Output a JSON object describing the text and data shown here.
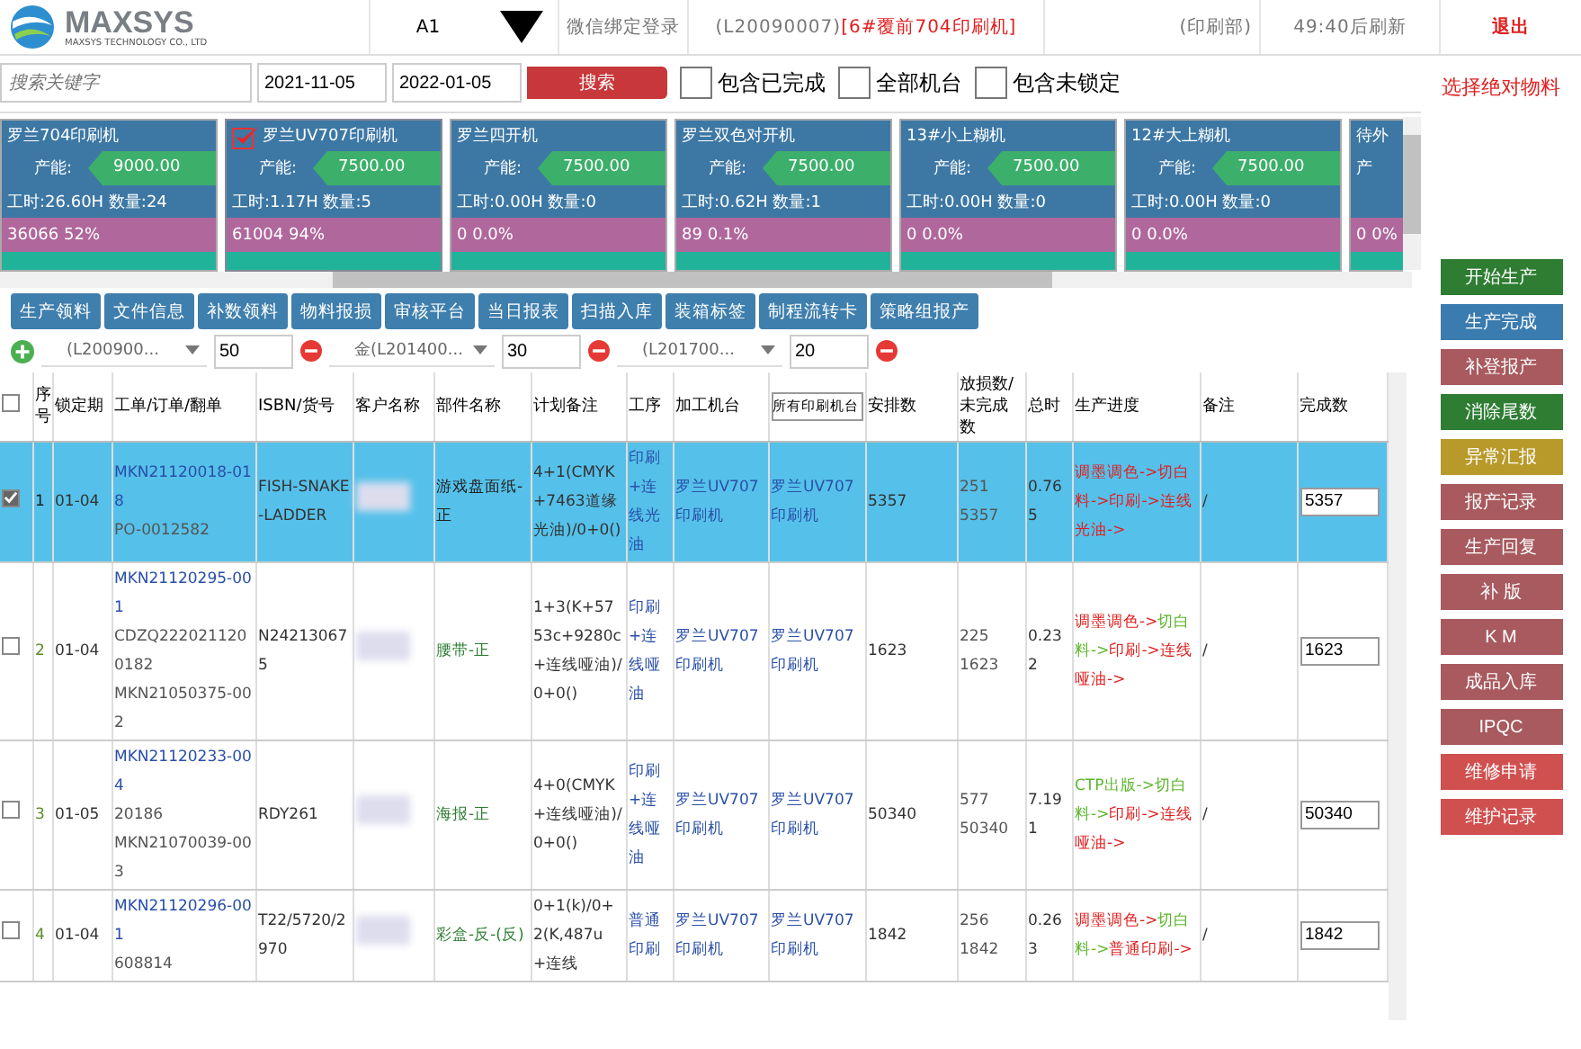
{
  "header": {
    "company": "MAXSYS",
    "tagline": "MAXSYS TECHNOLOGY CO., LTD",
    "station": "A1",
    "wechat_login": "微信绑定登录",
    "user": "(L20090007)",
    "machine": "[6#覆前704印刷机]",
    "department": "(印刷部)",
    "refresh": "49:40后刷新",
    "logout": "退出"
  },
  "search": {
    "placeholder": "搜索关键字",
    "date_from": "2021-11-05",
    "date_to": "2022-01-05",
    "button": "搜索",
    "options": [
      {
        "label": "包含已完成",
        "checked": false
      },
      {
        "label": "全部机台",
        "checked": false
      },
      {
        "label": "包含未锁定",
        "checked": false
      }
    ],
    "absolute_material": "选择绝对物料"
  },
  "machines": [
    {
      "name": "罗兰704印刷机",
      "selected": false,
      "capacity_label": "产能:",
      "capacity": "9000.00",
      "hours": "工时:26.60H 数量:24",
      "rate": "36066 52%"
    },
    {
      "name": "罗兰UV707印刷机",
      "selected": true,
      "capacity_label": "产能:",
      "capacity": "7500.00",
      "hours": "工时:1.17H 数量:5",
      "rate": "61004 94%"
    },
    {
      "name": "罗兰四开机",
      "selected": false,
      "capacity_label": "产能:",
      "capacity": "7500.00",
      "hours": "工时:0.00H 数量:0",
      "rate": "0 0.0%"
    },
    {
      "name": "罗兰双色对开机",
      "selected": false,
      "capacity_label": "产能:",
      "capacity": "7500.00",
      "hours": "工时:0.62H 数量:1",
      "rate": "89 0.1%"
    },
    {
      "name": "13#小上糊机",
      "selected": false,
      "capacity_label": "产能:",
      "capacity": "7500.00",
      "hours": "工时:0.00H 数量:0",
      "rate": "0 0.0%"
    },
    {
      "name": "12#大上糊机",
      "selected": false,
      "capacity_label": "产能:",
      "capacity": "7500.00",
      "hours": "工时:0.00H 数量:0",
      "rate": "0 0.0%"
    },
    {
      "name": "待外",
      "selected": false,
      "capacity_label": "产",
      "rate": "0 0%"
    }
  ],
  "toolbar": [
    "生产领料",
    "文件信息",
    "补数领料",
    "物料报损",
    "审核平台",
    "当日报表",
    "扫描入库",
    "装箱标签",
    "制程流转卡",
    "策略组报产"
  ],
  "materials": [
    {
      "item": "(L200900...",
      "qty": "50"
    },
    {
      "item": "金(L201400...",
      "qty": "30"
    },
    {
      "item": "(L201700...",
      "qty": "20"
    }
  ],
  "table": {
    "select_all_checked": false,
    "columns": [
      "序号",
      "锁定期",
      "工单/订单/翻单",
      "ISBN/货号",
      "客户名称",
      "部件名称",
      "计划备注",
      "工序",
      "加工机台",
      "所有印刷机台",
      "安排数",
      "放损数/未完成数",
      "总时",
      "生产进度",
      "备注",
      "完成数"
    ],
    "rows": [
      {
        "selected": true,
        "seq": "1",
        "date": "01-04",
        "orders": [
          "MKN21120018-018",
          "PO-0012582"
        ],
        "isbn": "FISH-SNAKE-LADDER",
        "part": "游戏盘面纸-正",
        "plan": "4+1(CMYK+7463道缘光油)/0+0()",
        "process": "印刷+连线光油",
        "machine": "罗兰UV707印刷机",
        "printer": "罗兰UV707印刷机",
        "arranged": "5357",
        "loss": "251",
        "remaining": "5357",
        "hours": "0.765",
        "steps": [
          {
            "text": "调墨调色->",
            "done": false
          },
          {
            "text": "切白料->",
            "done": false
          },
          {
            "text": "印刷->",
            "done": false
          },
          {
            "text": "连线光油->",
            "done": false
          }
        ],
        "note": "/",
        "completed": "5357"
      },
      {
        "selected": false,
        "seq": "2",
        "date": "01-04",
        "orders": [
          "MKN21120295-001",
          "CDZQ2220211200182",
          "MKN21050375-002"
        ],
        "isbn": "N242130675",
        "part": "腰带-正",
        "plan": "1+3(K+5753c+9280c+连线哑油)/0+0()",
        "process": "印刷+连线哑油",
        "machine": "罗兰UV707印刷机",
        "printer": "罗兰UV707印刷机",
        "arranged": "1623",
        "loss": "225",
        "remaining": "1623",
        "hours": "0.232",
        "steps": [
          {
            "text": "调墨调色->",
            "done": false
          },
          {
            "text": "切白料->",
            "done": true
          },
          {
            "text": "印刷->",
            "done": false
          },
          {
            "text": "连线哑油->",
            "done": false
          }
        ],
        "note": "/",
        "completed": "1623"
      },
      {
        "selected": false,
        "seq": "3",
        "date": "01-05",
        "orders": [
          "MKN21120233-004",
          "20186",
          "MKN21070039-003"
        ],
        "isbn": "RDY261",
        "part": "海报-正",
        "plan": "4+0(CMYK+连线哑油)/0+0()",
        "process": "印刷+连线哑油",
        "machine": "罗兰UV707印刷机",
        "printer": "罗兰UV707印刷机",
        "arranged": "50340",
        "loss": "577",
        "remaining": "50340",
        "hours": "7.191",
        "steps": [
          {
            "text": "CTP出版->",
            "done": true
          },
          {
            "text": "切白料->",
            "done": true
          },
          {
            "text": "印刷->",
            "done": false
          },
          {
            "text": "连线哑油->",
            "done": false
          }
        ],
        "note": "/",
        "completed": "50340"
      },
      {
        "selected": false,
        "seq": "4",
        "date": "01-04",
        "orders": [
          "MKN21120296-001",
          "608814"
        ],
        "isbn": "T22/5720/2970",
        "part": "彩盒-反-(反)",
        "plan": "0+1(k)/0+2(K,487u+连线",
        "process": "普通印刷",
        "machine": "罗兰UV707印刷机",
        "printer": "罗兰UV707印刷机",
        "arranged": "1842",
        "loss": "256",
        "remaining": "1842",
        "hours": "0.263",
        "steps": [
          {
            "text": "调墨调色->",
            "done": false
          },
          {
            "text": "切白料->",
            "done": true
          },
          {
            "text": "普通印刷->",
            "done": false
          }
        ],
        "note": "/",
        "completed": "1842"
      }
    ]
  },
  "actions": [
    {
      "label": "开始生产",
      "color": "#2e7d32"
    },
    {
      "label": "生产完成",
      "color": "#3a7bb0"
    },
    {
      "label": "补登报产",
      "color": "#a85a5f"
    },
    {
      "label": "消除尾数",
      "color": "#2e7d32"
    },
    {
      "label": "异常汇报",
      "color": "#b89a2a"
    },
    {
      "label": "报产记录",
      "color": "#a85a5f"
    },
    {
      "label": "生产回复",
      "color": "#a85a5f"
    },
    {
      "label": "补 版",
      "color": "#a85a5f"
    },
    {
      "label": "K M",
      "color": "#a85a5f"
    },
    {
      "label": "成品入库",
      "color": "#a85a5f"
    },
    {
      "label": "IPQC",
      "color": "#a85a5f"
    },
    {
      "label": "维修申请",
      "color": "#d05050"
    },
    {
      "label": "维护记录",
      "color": "#d05050"
    }
  ]
}
